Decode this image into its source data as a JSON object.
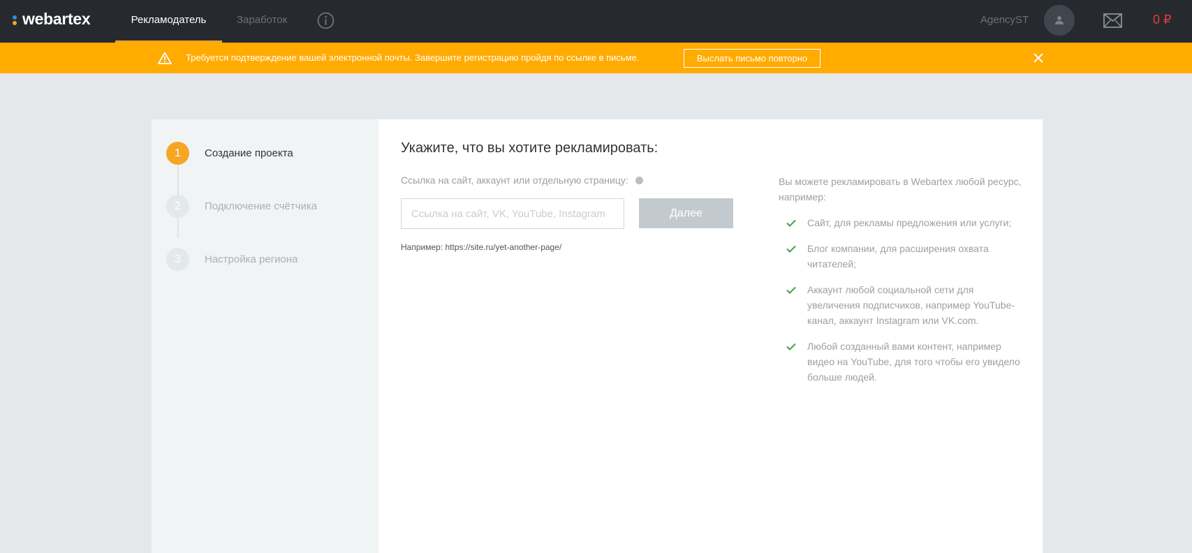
{
  "header": {
    "logo_text": "webartex",
    "tabs": [
      {
        "label": "Рекламодатель",
        "active": true
      },
      {
        "label": "Заработок",
        "active": false
      }
    ],
    "user_name": "AgencyST",
    "balance": "0 ₽",
    "icons": [
      "info-icon",
      "user-icon",
      "mail-icon"
    ]
  },
  "banner": {
    "text": "Требуется подтверждение вашей электронной почты. Завершите регистрацию пройдя по ссылке в письме.",
    "button_label": "Выслать письмо повторно",
    "icons": [
      "warning-icon",
      "close-icon"
    ]
  },
  "steps": [
    {
      "number": "1",
      "label": "Создание проекта",
      "active": true
    },
    {
      "number": "2",
      "label": "Подключение счётчика",
      "active": false
    },
    {
      "number": "3",
      "label": "Настройка региона",
      "active": false
    }
  ],
  "form": {
    "title": "Укажите, что вы хотите рекламировать:",
    "field_label": "Ссылка на сайт, аккаунт или отдельную страницу:",
    "input_value": "",
    "input_placeholder": "Ссылка на сайт, VK, YouTube, Instagram",
    "next_button": "Далее",
    "example": "Например: https://site.ru/yet-another-page/"
  },
  "aside": {
    "intro": "Вы можете рекламировать в Webartex любой ресурс, например:",
    "items": [
      "Сайт, для рекламы предложения или услуги;",
      "Блог компании, для расширения охвата читателей;",
      "Аккаунт любой социальной сети для увеличения подписчиков, например YouTube-канал, аккаунт Instagram или VK.com.",
      "Любой созданный вами контент, например видео на YouTube, для того чтобы его увидело больше людей."
    ]
  },
  "colors": {
    "topbar": "#262a2f",
    "accent": "#f5a623",
    "banner": "#ffab00",
    "balance": "#e43b3b",
    "check": "#43a047",
    "page_bg": "#e4e8ea"
  }
}
